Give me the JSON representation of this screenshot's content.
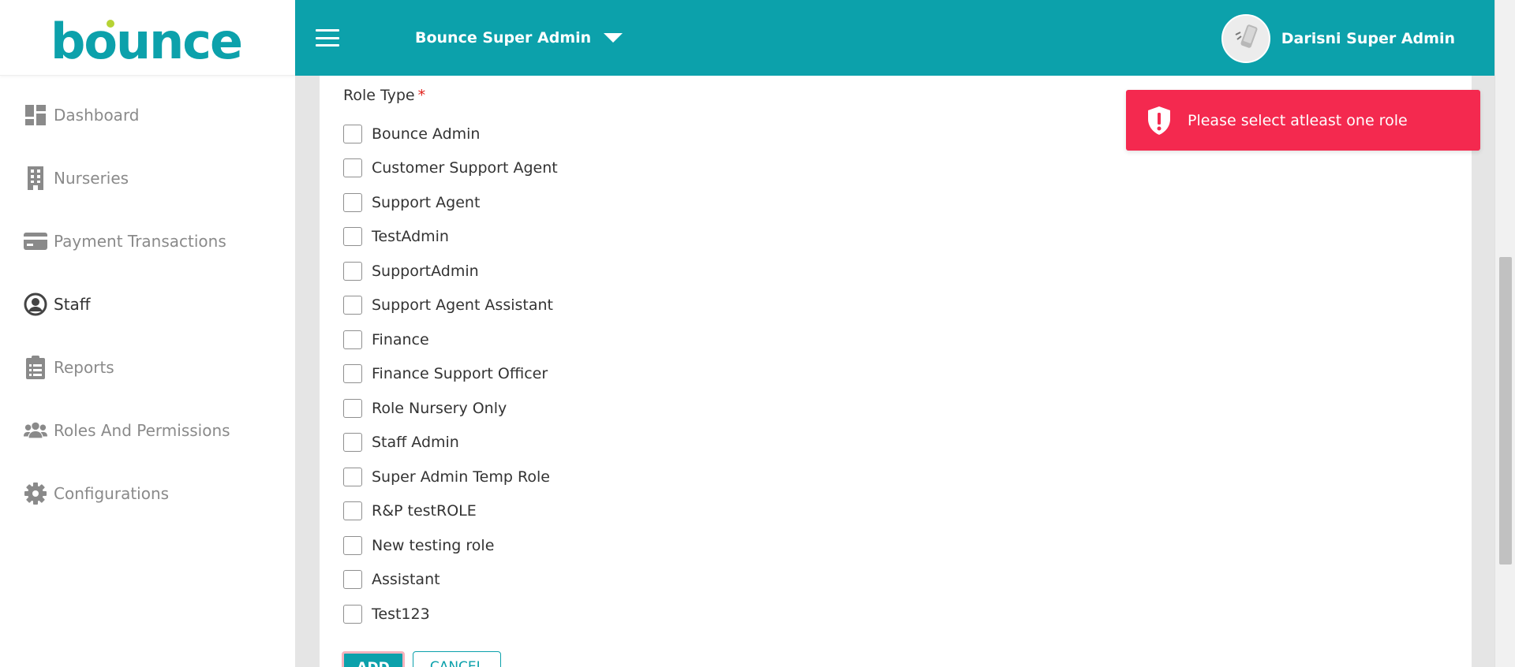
{
  "brand": {
    "logo_text": "bounce",
    "color": "#0ca1ab",
    "dot_color": "#b6d334"
  },
  "sidebar": {
    "items": [
      {
        "label": "Dashboard",
        "icon": "dashboard-icon",
        "active": false
      },
      {
        "label": "Nurseries",
        "icon": "building-icon",
        "active": false
      },
      {
        "label": "Payment Transactions",
        "icon": "credit-card-icon",
        "active": false
      },
      {
        "label": "Staff",
        "icon": "user-circle-icon",
        "active": true
      },
      {
        "label": "Reports",
        "icon": "clipboard-list-icon",
        "active": false
      },
      {
        "label": "Roles And Permissions",
        "icon": "users-icon",
        "active": false
      },
      {
        "label": "Configurations",
        "icon": "gear-icon",
        "active": false
      }
    ]
  },
  "header": {
    "org_name": "Bounce Super Admin",
    "user_name": "Darisni Super Admin",
    "menu_icon": "hamburger-menu-icon",
    "dropdown_icon": "caret-down-icon"
  },
  "form": {
    "role_type_label": "Role Type",
    "required_marker": "*",
    "roles": [
      "Bounce Admin",
      "Customer Support Agent",
      "Support Agent",
      "TestAdmin",
      "SupportAdmin",
      "Support Agent Assistant",
      "Finance",
      "Finance Support Officer",
      "Role Nursery Only",
      "Staff Admin",
      "Super Admin Temp Role",
      "R&P testROLE",
      "New testing role",
      "Assistant",
      "Test123"
    ],
    "add_label": "ADD",
    "cancel_label": "CANCEL"
  },
  "toast": {
    "message": "Please select atleast one role",
    "icon": "shield-exclamation-icon",
    "color": "#f4294f"
  }
}
